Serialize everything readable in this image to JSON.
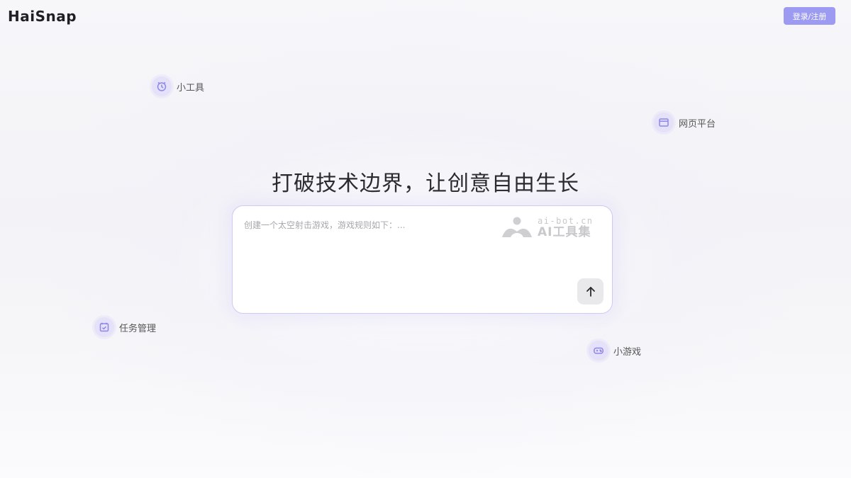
{
  "header": {
    "logo": "HaiSnap",
    "login_label": "登录/注册"
  },
  "floating_tags": {
    "tools": {
      "label": "小工具",
      "icon": "clock-icon"
    },
    "web": {
      "label": "网页平台",
      "icon": "browser-window-icon"
    },
    "tasks": {
      "label": "任务管理",
      "icon": "calendar-check-icon"
    },
    "games": {
      "label": "小游戏",
      "icon": "gamepad-icon"
    }
  },
  "main": {
    "headline": "打破技术边界，让创意自由生长",
    "prompt_placeholder": "创建一个太空射击游戏，游戏规则如下：...",
    "send_icon": "arrow-up-icon"
  },
  "watermark": {
    "url": "ai-bot.cn",
    "name": "AI工具集"
  },
  "colors": {
    "accent": "#9d9af1",
    "icon_bg": "#e4e1f8",
    "icon_stroke": "#8d87e8"
  }
}
